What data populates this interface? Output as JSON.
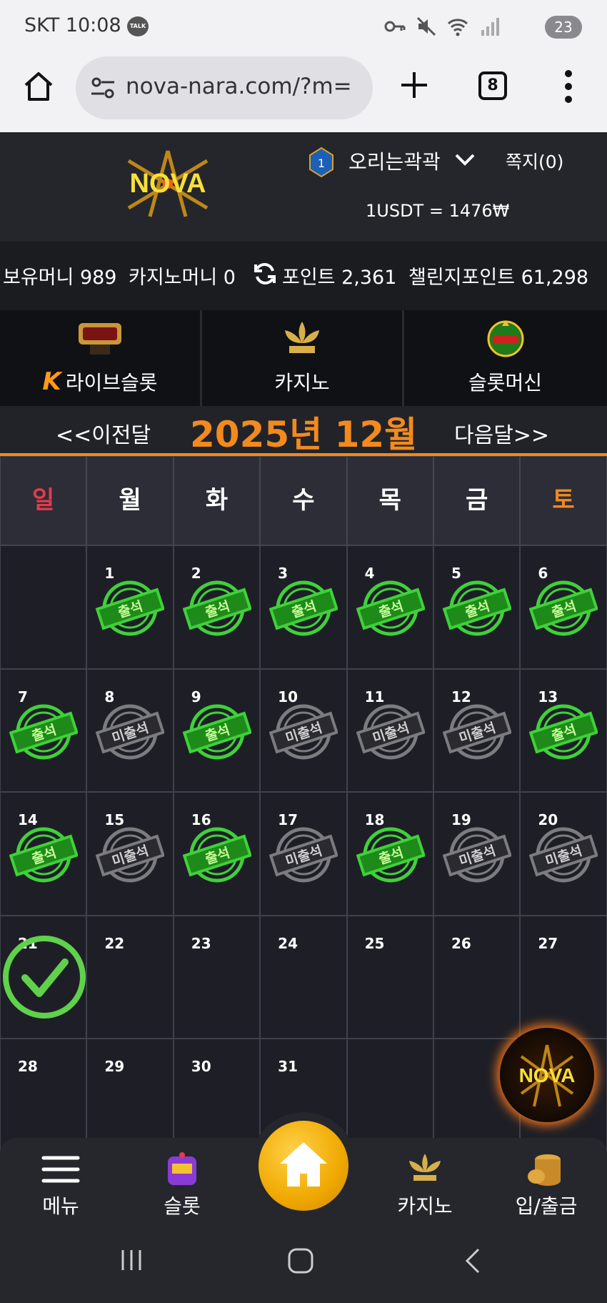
{
  "status_bar": {
    "carrier_time": "SKT 10:08",
    "talk_badge": "TALK",
    "battery": "23"
  },
  "browser": {
    "url": "nova-nara.com/?m=",
    "tab_count": "8"
  },
  "header": {
    "username": "오리는곽곽",
    "rank_level": "1",
    "messages": "쪽지(0)",
    "exchange_rate": "1USDT = 1476₩"
  },
  "balances": {
    "hold_money": "보유머니 989",
    "casino_money": "카지노머니 0",
    "points": "포인트 2,361",
    "challenge_points": "챌린지포인트 61,298"
  },
  "categories": [
    {
      "label": "라이브슬롯",
      "icon": "live-slot-icon",
      "k": "K"
    },
    {
      "label": "카지노",
      "icon": "kslot-lotus-icon"
    },
    {
      "label": "슬롯머신",
      "icon": "777-slots-icon"
    }
  ],
  "calendar": {
    "prev": "<<이전달",
    "month": "2025년 12월",
    "next": "다음달>>",
    "weekdays": [
      "일",
      "월",
      "화",
      "수",
      "목",
      "금",
      "토"
    ],
    "attended_label": "출석",
    "absent_label": "미출석",
    "days": [
      {
        "n": ""
      },
      {
        "n": "1",
        "s": "attended"
      },
      {
        "n": "2",
        "s": "attended"
      },
      {
        "n": "3",
        "s": "attended"
      },
      {
        "n": "4",
        "s": "attended"
      },
      {
        "n": "5",
        "s": "attended"
      },
      {
        "n": "6",
        "s": "attended"
      },
      {
        "n": "7",
        "s": "attended"
      },
      {
        "n": "8",
        "s": "absent"
      },
      {
        "n": "9",
        "s": "attended"
      },
      {
        "n": "10",
        "s": "absent"
      },
      {
        "n": "11",
        "s": "absent"
      },
      {
        "n": "12",
        "s": "absent"
      },
      {
        "n": "13",
        "s": "attended"
      },
      {
        "n": "14",
        "s": "attended"
      },
      {
        "n": "15",
        "s": "absent"
      },
      {
        "n": "16",
        "s": "attended"
      },
      {
        "n": "17",
        "s": "absent"
      },
      {
        "n": "18",
        "s": "attended"
      },
      {
        "n": "19",
        "s": "absent"
      },
      {
        "n": "20",
        "s": "absent"
      },
      {
        "n": "21",
        "s": "today"
      },
      {
        "n": "22"
      },
      {
        "n": "23"
      },
      {
        "n": "24"
      },
      {
        "n": "25"
      },
      {
        "n": "26"
      },
      {
        "n": "27"
      },
      {
        "n": "28"
      },
      {
        "n": "29"
      },
      {
        "n": "30"
      },
      {
        "n": "31"
      },
      {
        "n": ""
      },
      {
        "n": ""
      },
      {
        "n": ""
      }
    ]
  },
  "bottom_nav": {
    "menu": "메뉴",
    "slot": "슬롯",
    "casino": "카지노",
    "banking": "입/출금"
  },
  "colors": {
    "accent": "#f28a1e",
    "attended": "#3fd13a",
    "absent": "#7c7c80",
    "sunday": "#e43b4d"
  },
  "logo_text": "NOVA"
}
